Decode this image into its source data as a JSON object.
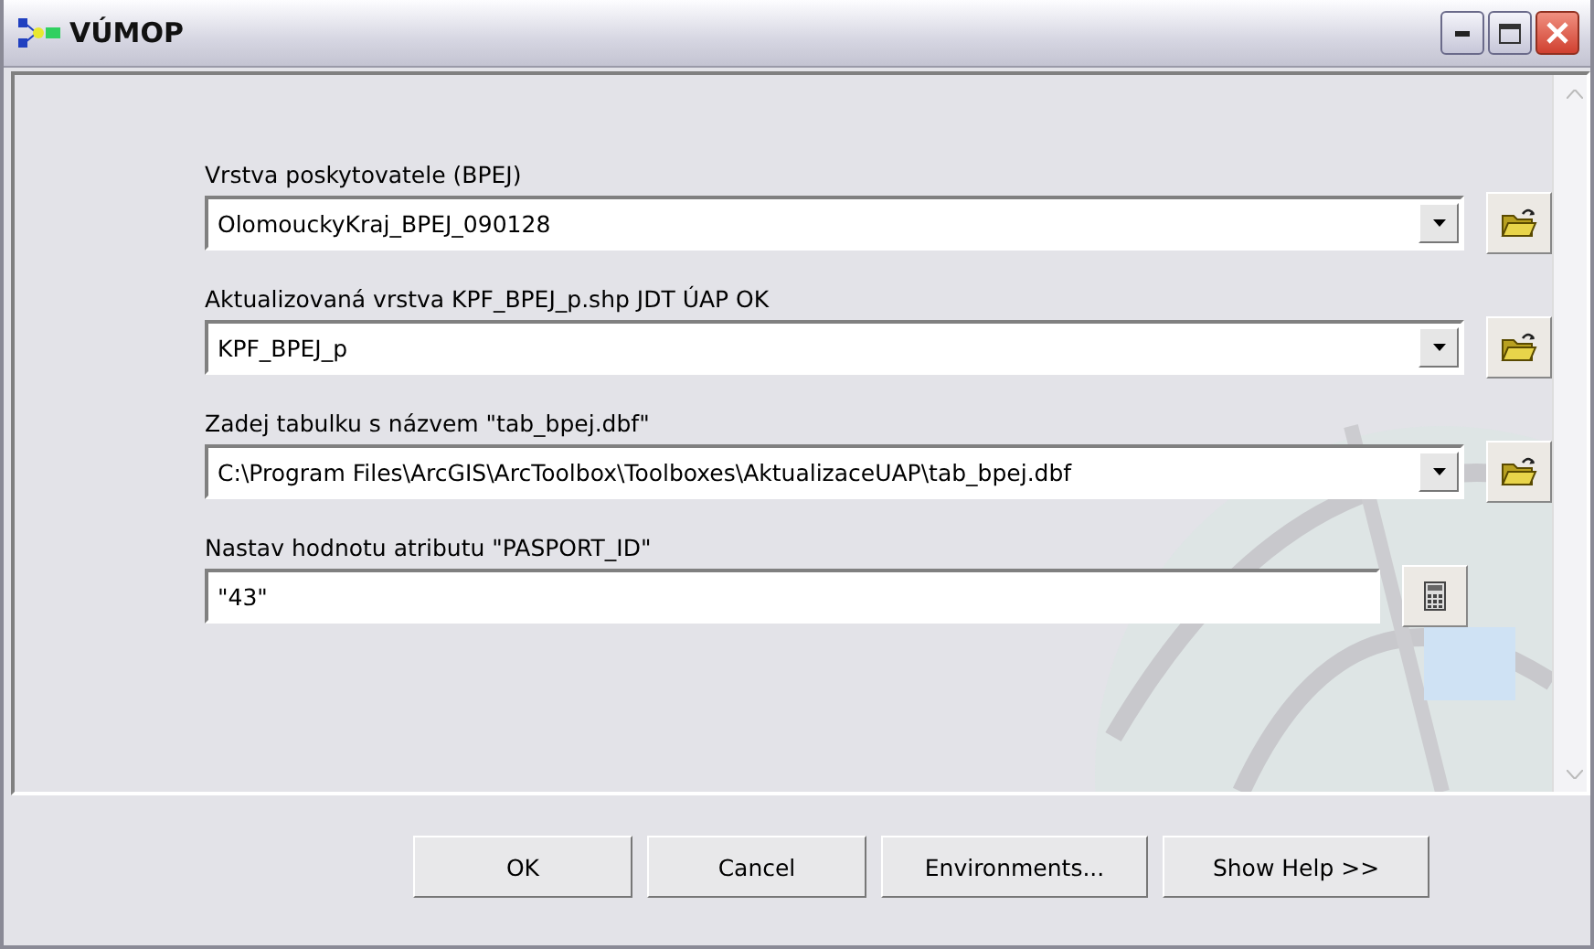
{
  "window": {
    "title": "VÚMOP"
  },
  "parameters": [
    {
      "label": "Vrstva poskytovatele (BPEJ)",
      "kind": "combo",
      "value": "OlomouckyKraj_BPEJ_090128",
      "button": {
        "kind": "folder"
      }
    },
    {
      "label": "Aktualizovaná vrstva KPF_BPEJ_p.shp JDT ÚAP OK",
      "kind": "combo",
      "value": "KPF_BPEJ_p",
      "button": {
        "kind": "folder"
      }
    },
    {
      "label": "Zadej tabulku s názvem \"tab_bpej.dbf\"",
      "kind": "combo",
      "value": "C:\\Program Files\\ArcGIS\\ArcToolbox\\Toolboxes\\AktualizaceUAP\\tab_bpej.dbf",
      "button": {
        "kind": "folder"
      }
    },
    {
      "label": "Nastav hodnotu atributu \"PASPORT_ID\"",
      "kind": "text",
      "value": "\"43\"",
      "button": {
        "kind": "calculator"
      }
    }
  ],
  "buttons": [
    "OK",
    "Cancel",
    "Environments...",
    "Show Help >>"
  ]
}
